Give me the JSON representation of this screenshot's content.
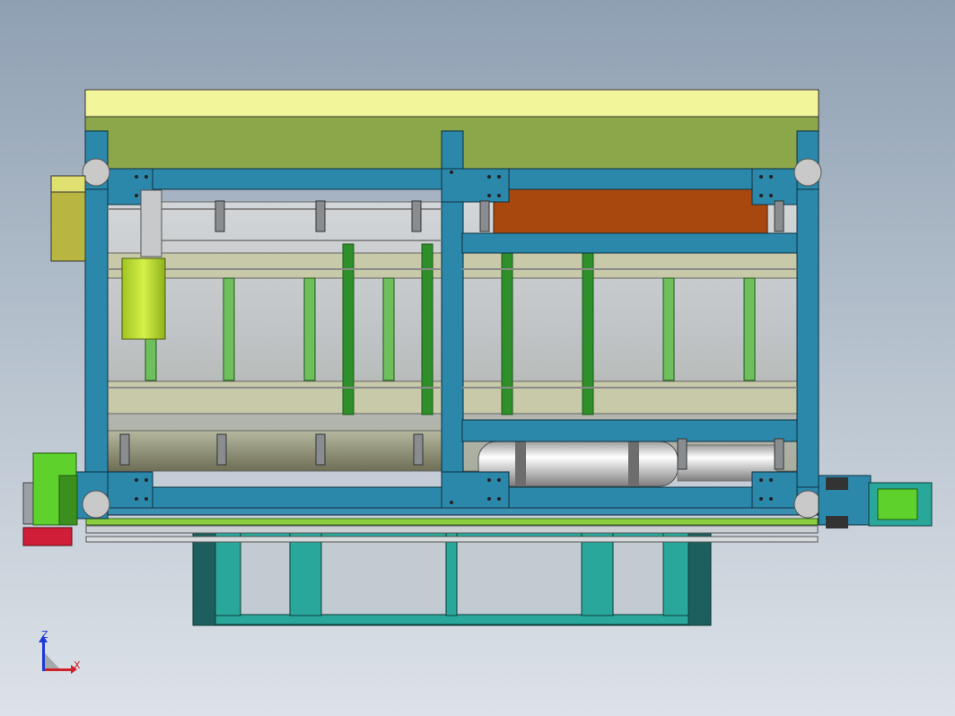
{
  "viewport": {
    "background_top": "#8fa0b3",
    "background_bottom": "#dde2e8"
  },
  "colors": {
    "frame_blue": "#2b88ab",
    "frame_dark": "#1d6f8e",
    "top_yellow": "#f3f59a",
    "olive": "#8ca64a",
    "orange": "#a8480e",
    "lime": "#b8dc2e",
    "green_motor": "#5fd12c",
    "red_base": "#d01e38",
    "teal_base": "#2aa79b",
    "teal_dark": "#1d5f5e",
    "grey_panel": "#c4c8cc",
    "cylinder": "#d8d8d8"
  },
  "triad": {
    "z_label": "Z",
    "x_label": "X",
    "z_color": "#1d3ad6",
    "x_color": "#d0202a"
  }
}
